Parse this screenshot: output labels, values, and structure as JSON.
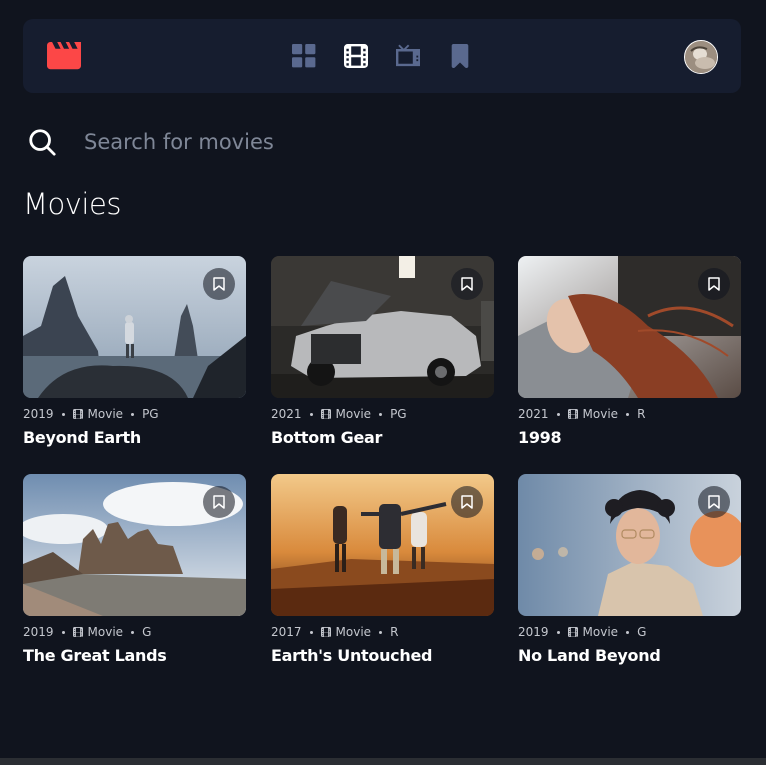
{
  "nav": {
    "logo_icon": "movie-clapper-icon",
    "items": [
      {
        "name": "home",
        "icon": "grid-icon",
        "active": false
      },
      {
        "name": "movies",
        "icon": "film-icon",
        "active": true
      },
      {
        "name": "tv-series",
        "icon": "tv-icon",
        "active": false
      },
      {
        "name": "bookmarks",
        "icon": "bookmark-icon",
        "active": false
      }
    ],
    "avatar_icon": "user-avatar"
  },
  "search": {
    "placeholder": "Search for movies",
    "value": ""
  },
  "section": {
    "title": "Movies"
  },
  "movies": [
    {
      "year": "2019",
      "category": "Movie",
      "rating": "PG",
      "title": "Beyond Earth"
    },
    {
      "year": "2021",
      "category": "Movie",
      "rating": "PG",
      "title": "Bottom Gear"
    },
    {
      "year": "2021",
      "category": "Movie",
      "rating": "R",
      "title": "1998"
    },
    {
      "year": "2019",
      "category": "Movie",
      "rating": "G",
      "title": "The Great Lands"
    },
    {
      "year": "2017",
      "category": "Movie",
      "rating": "R",
      "title": "Earth's Untouched"
    },
    {
      "year": "2019",
      "category": "Movie",
      "rating": "G",
      "title": "No Land Beyond"
    }
  ],
  "colors": {
    "background": "#10141E",
    "surface": "#161D2F",
    "accent": "#FC4747",
    "nav_icon": "#5A698F",
    "text": "#FFFFFF"
  }
}
